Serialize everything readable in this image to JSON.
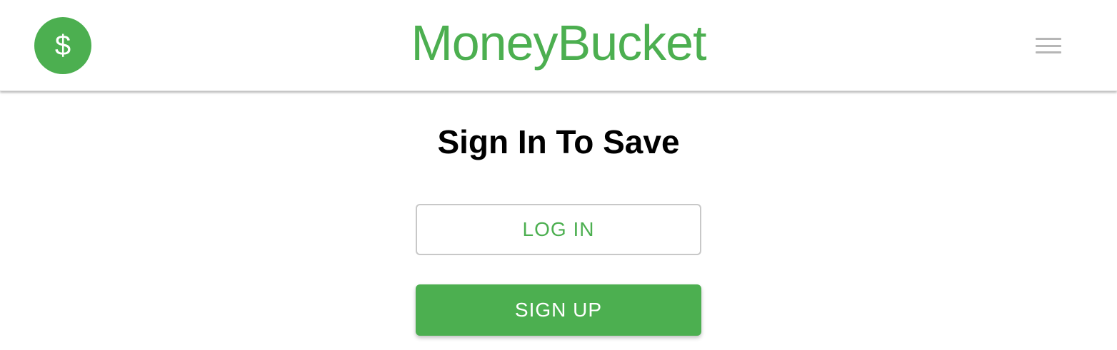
{
  "header": {
    "logo_symbol": "$",
    "app_title": "MoneyBucket",
    "menu_icon": "hamburger-menu-icon"
  },
  "main": {
    "heading": "Sign In To Save",
    "login_label": "LOG IN",
    "signup_label": "SIGN UP"
  },
  "colors": {
    "brand_green": "#4caf50",
    "menu_gray": "#b6b6b6",
    "text_black": "#000000",
    "border_gray": "#c8c8c8"
  }
}
